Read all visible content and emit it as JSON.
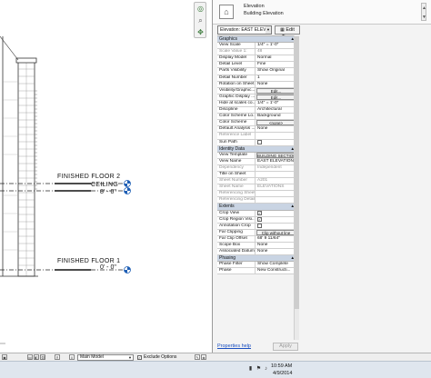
{
  "drawing": {
    "level_upper_name": "FINISHED FLOOR 2",
    "level_upper_value": "8' - 0\"",
    "level_ceiling_name": "CEILING",
    "level_ceiling_value": "8' - 0\"",
    "level_lower_name": "FINISHED FLOOR 1",
    "level_lower_value": "0' - 0\""
  },
  "properties": {
    "type_family": "Elevation",
    "type_name": "Building Elevation",
    "filter_value": "Elevation: EAST ELEVA",
    "edit_type_label": "Edit Type",
    "help_link": "Properties help",
    "apply_label": "Apply",
    "sections": [
      {
        "title": "Graphics",
        "rows": [
          {
            "k": "View Scale",
            "v": "1/4\" = 1'-0\""
          },
          {
            "k": "Scale Value 1:",
            "v": "48",
            "dim": true
          },
          {
            "k": "Display Model",
            "v": "Normal"
          },
          {
            "k": "Detail Level",
            "v": "Fine"
          },
          {
            "k": "Parts Visibility",
            "v": "Show Original"
          },
          {
            "k": "Detail Number",
            "v": "1"
          },
          {
            "k": "Rotation on Sheet",
            "v": "None"
          },
          {
            "k": "Visibility/Graphic...",
            "v": "Edit...",
            "button": true
          },
          {
            "k": "Graphic Display ...",
            "v": "Edit...",
            "button": true
          },
          {
            "k": "Hide at scales co...",
            "v": "1/4\" = 1'-0\""
          },
          {
            "k": "Discipline",
            "v": "Architectural"
          },
          {
            "k": "Color Scheme Lo...",
            "v": "Background"
          },
          {
            "k": "Color Scheme",
            "v": "<none>",
            "button": true
          },
          {
            "k": "Default Analysis ...",
            "v": "None"
          },
          {
            "k": "Reference Label",
            "v": "",
            "dim": true
          },
          {
            "k": "Sun Path",
            "v": "",
            "check": false
          }
        ]
      },
      {
        "title": "Identity Data",
        "rows": [
          {
            "k": "View Template",
            "v": "BUILDING SECTIONS",
            "button": true
          },
          {
            "k": "View Name",
            "v": "EAST ELEVATION"
          },
          {
            "k": "Dependency",
            "v": "Independent",
            "dim": true
          },
          {
            "k": "Title on Sheet",
            "v": ""
          },
          {
            "k": "Sheet Number",
            "v": "A201",
            "dim": true
          },
          {
            "k": "Sheet Name",
            "v": "ELEVATIONS",
            "dim": true
          },
          {
            "k": "Referencing Sheet",
            "v": "",
            "dim": true
          },
          {
            "k": "Referencing Detail",
            "v": "",
            "dim": true
          }
        ]
      },
      {
        "title": "Extents",
        "rows": [
          {
            "k": "Crop View",
            "v": "",
            "check": true
          },
          {
            "k": "Crop Region Visi...",
            "v": "",
            "check": true
          },
          {
            "k": "Annotation Crop",
            "v": "",
            "check": false
          },
          {
            "k": "Far Clipping",
            "v": "Clip without line",
            "button": true
          },
          {
            "k": "Far Clip Offset",
            "v": "68' 9 11/64\""
          },
          {
            "k": "Scope Box",
            "v": "None"
          },
          {
            "k": "Associated Datum",
            "v": "None"
          }
        ]
      },
      {
        "title": "Phasing",
        "rows": [
          {
            "k": "Phase Filter",
            "v": "Show Complete"
          },
          {
            "k": "Phase",
            "v": "New Constructi..."
          }
        ]
      }
    ]
  },
  "status": {
    "model_value": "Main Model",
    "exclude_label": "Exclude Options"
  },
  "taskbar": {
    "time": "10:59 AM",
    "date": "4/9/2014"
  },
  "colors": {
    "section_header": "#c9d4e3",
    "level_marker": "#1f5fb5",
    "link": "#1a4fc0"
  }
}
